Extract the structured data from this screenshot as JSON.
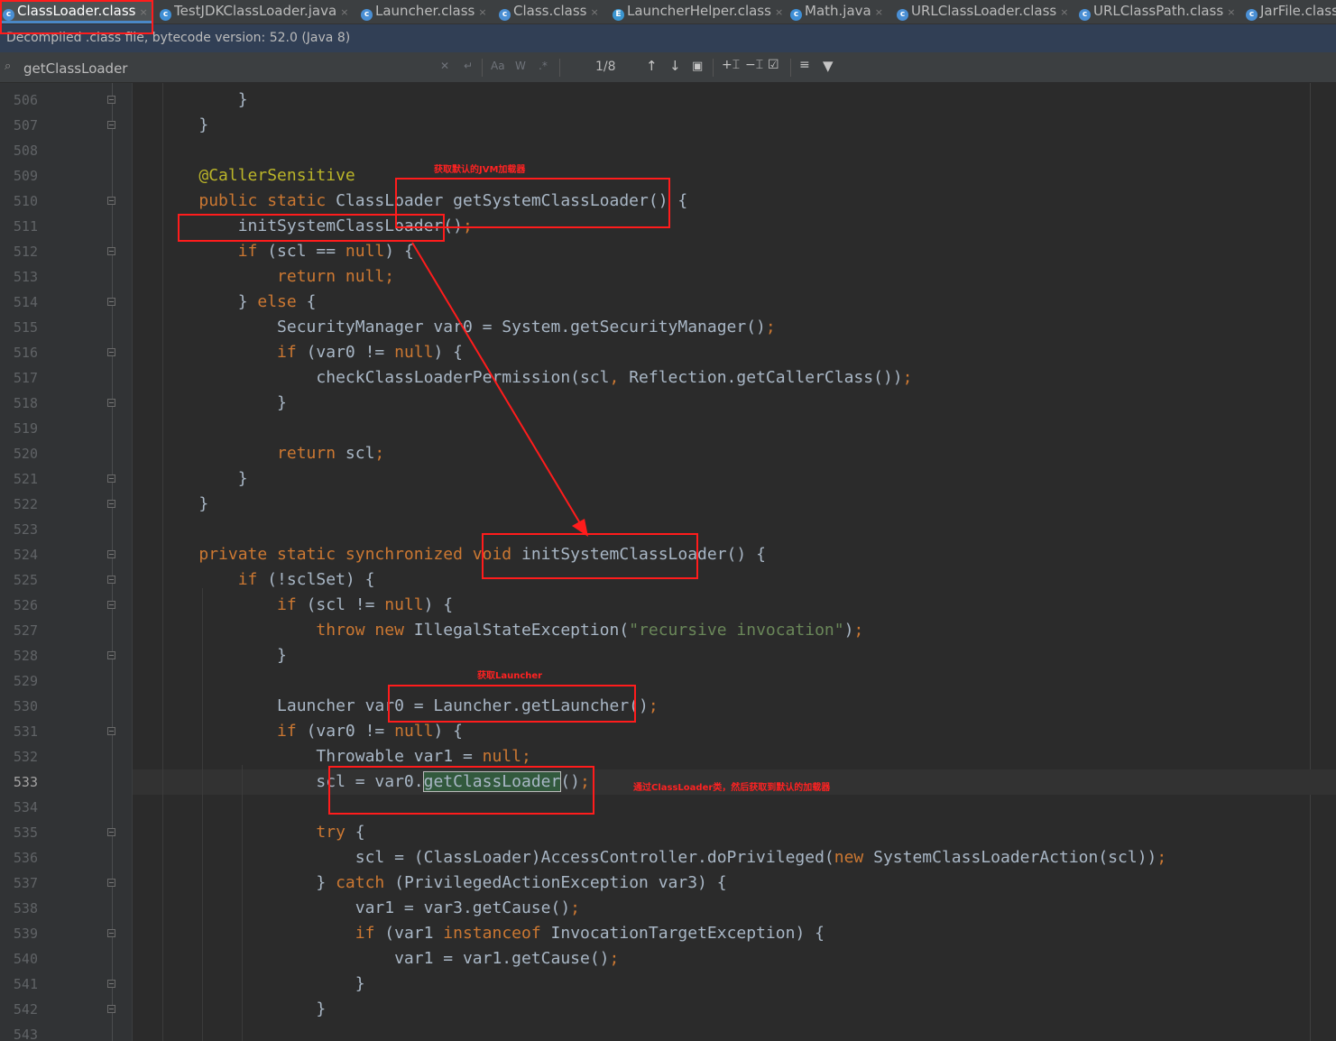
{
  "tabs": [
    {
      "label": "ClassLoader.class",
      "type": "class",
      "active": true
    },
    {
      "label": "TestJDKClassLoader.java",
      "type": "java",
      "active": false
    },
    {
      "label": "Launcher.class",
      "type": "class",
      "active": false
    },
    {
      "label": "Class.class",
      "type": "class",
      "active": false
    },
    {
      "label": "LauncherHelper.class",
      "type": "enum",
      "active": false
    },
    {
      "label": "Math.java",
      "type": "java",
      "active": false
    },
    {
      "label": "URLClassLoader.class",
      "type": "class",
      "active": false
    },
    {
      "label": "URLClassPath.class",
      "type": "class",
      "active": false
    },
    {
      "label": "JarFile.class",
      "type": "class",
      "active": false
    }
  ],
  "info_bar": "Decompiled .class file, bytecode version: 52.0 (Java 8)",
  "search": {
    "value": "getClassLoader",
    "match_case": "Aa",
    "words": "W",
    "regex": ".*",
    "match_count": "1/8"
  },
  "lines": [
    {
      "n": "506",
      "html": "        }"
    },
    {
      "n": "507",
      "html": "    }"
    },
    {
      "n": "508",
      "html": ""
    },
    {
      "n": "509",
      "html": "    <span class=\"an\">@CallerSensitive</span>"
    },
    {
      "n": "510",
      "html": "    <span class=\"kw\">public static </span>ClassLoader getSystemClassLoader() {"
    },
    {
      "n": "511",
      "html": "        initSystemClassLoader()<span class=\"kw\">;</span>"
    },
    {
      "n": "512",
      "html": "        <span class=\"kw\">if </span>(scl == <span class=\"kw\">null</span>) {"
    },
    {
      "n": "513",
      "html": "            <span class=\"kw\">return null;</span>"
    },
    {
      "n": "514",
      "html": "        } <span class=\"kw\">else </span>{"
    },
    {
      "n": "515",
      "html": "            SecurityManager var0 = System.getSecurityManager()<span class=\"kw\">;</span>"
    },
    {
      "n": "516",
      "html": "            <span class=\"kw\">if </span>(var0 != <span class=\"kw\">null</span>) {"
    },
    {
      "n": "517",
      "html": "                checkClassLoaderPermission(scl<span class=\"kw\">, </span>Reflection.getCallerClass())<span class=\"kw\">;</span>"
    },
    {
      "n": "518",
      "html": "            }"
    },
    {
      "n": "519",
      "html": ""
    },
    {
      "n": "520",
      "html": "            <span class=\"kw\">return </span>scl<span class=\"kw\">;</span>"
    },
    {
      "n": "521",
      "html": "        }"
    },
    {
      "n": "522",
      "html": "    }"
    },
    {
      "n": "523",
      "html": ""
    },
    {
      "n": "524",
      "html": "    <span class=\"kw\">private static synchronized void </span>initSystemClassLoader() {"
    },
    {
      "n": "525",
      "html": "        <span class=\"kw\">if </span>(!sclSet) {"
    },
    {
      "n": "526",
      "html": "            <span class=\"kw\">if </span>(scl != <span class=\"kw\">null</span>) {"
    },
    {
      "n": "527",
      "html": "                <span class=\"kw\">throw new </span>IllegalStateException(<span class=\"str\">\"recursive invocation\"</span>)<span class=\"kw\">;</span>"
    },
    {
      "n": "528",
      "html": "            }"
    },
    {
      "n": "529",
      "html": ""
    },
    {
      "n": "530",
      "html": "            Launcher var0 = Launcher.getLauncher()<span class=\"kw\">;</span>"
    },
    {
      "n": "531",
      "html": "            <span class=\"kw\">if </span>(var0 != <span class=\"kw\">null</span>) {"
    },
    {
      "n": "532",
      "html": "                Throwable var1 = <span class=\"kw\">null;</span>"
    },
    {
      "n": "533",
      "html": "                scl = var0.<span class=\"hl\">getClassLoader</span>()<span class=\"kw\">;</span>"
    },
    {
      "n": "534",
      "html": ""
    },
    {
      "n": "535",
      "html": "                <span class=\"kw\">try </span>{"
    },
    {
      "n": "536",
      "html": "                    scl = (ClassLoader)AccessController.doPrivileged(<span class=\"kw\">new </span>SystemClassLoaderAction(scl))<span class=\"kw\">;</span>"
    },
    {
      "n": "537",
      "html": "                } <span class=\"kw\">catch </span>(PrivilegedActionException var3) {"
    },
    {
      "n": "538",
      "html": "                    var1 = var3.getCause()<span class=\"kw\">;</span>"
    },
    {
      "n": "539",
      "html": "                    <span class=\"kw\">if </span>(var1 <span class=\"kw\">instanceof </span>InvocationTargetException) {"
    },
    {
      "n": "540",
      "html": "                        var1 = var1.getCause()<span class=\"kw\">;</span>"
    },
    {
      "n": "541",
      "html": "                    }"
    },
    {
      "n": "542",
      "html": "                }"
    },
    {
      "n": "543",
      "html": ""
    }
  ],
  "current_line": "533",
  "annotations": [
    {
      "text": "获取默认的JVM加载器"
    },
    {
      "text": "获取Launcher"
    },
    {
      "text": "通过ClassLoader类，然后获取到默认的加载器"
    }
  ],
  "colors": {
    "keyword": "#cc7832",
    "annotation": "#bbb529",
    "string": "#6a8759",
    "text": "#a9b7c6",
    "markup_red": "#ff1c1c"
  }
}
